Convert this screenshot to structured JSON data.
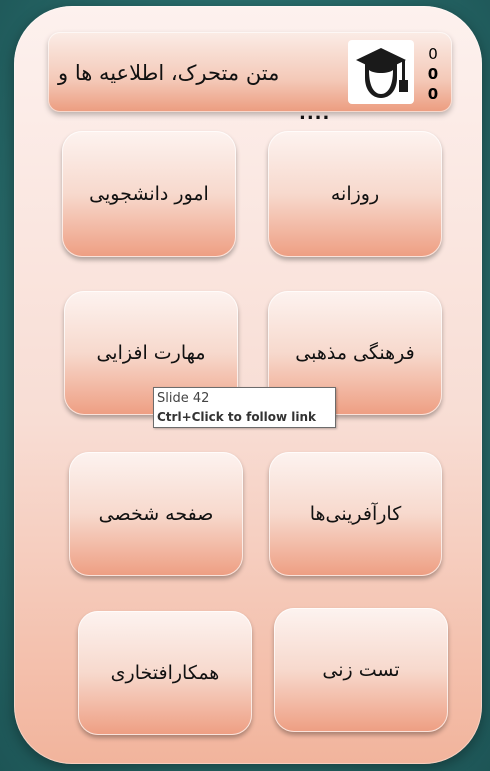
{
  "header": {
    "marquee_text": "متن متحرک، اطلاعیه ها و",
    "ellipsis": "....",
    "logo_icon": "graduate-cap-icon",
    "counters": [
      "0",
      "0",
      "0"
    ]
  },
  "tiles": [
    {
      "label": "امور دانشجویی"
    },
    {
      "label": "روزانه"
    },
    {
      "label": "مهارت افزایی"
    },
    {
      "label": "فرهنگی مذهبی"
    },
    {
      "label": "صفحه شخصی"
    },
    {
      "label": "کارآفرینی‌ها"
    },
    {
      "label": "همکارافتخاری"
    },
    {
      "label": "تست زنی"
    }
  ],
  "tooltip": {
    "title": "Slide 42",
    "hint": "Ctrl+Click to follow link"
  },
  "colors": {
    "background": "#2a6e6d",
    "tile_top": "#fdf3f0",
    "tile_bottom": "#ee9e82"
  }
}
